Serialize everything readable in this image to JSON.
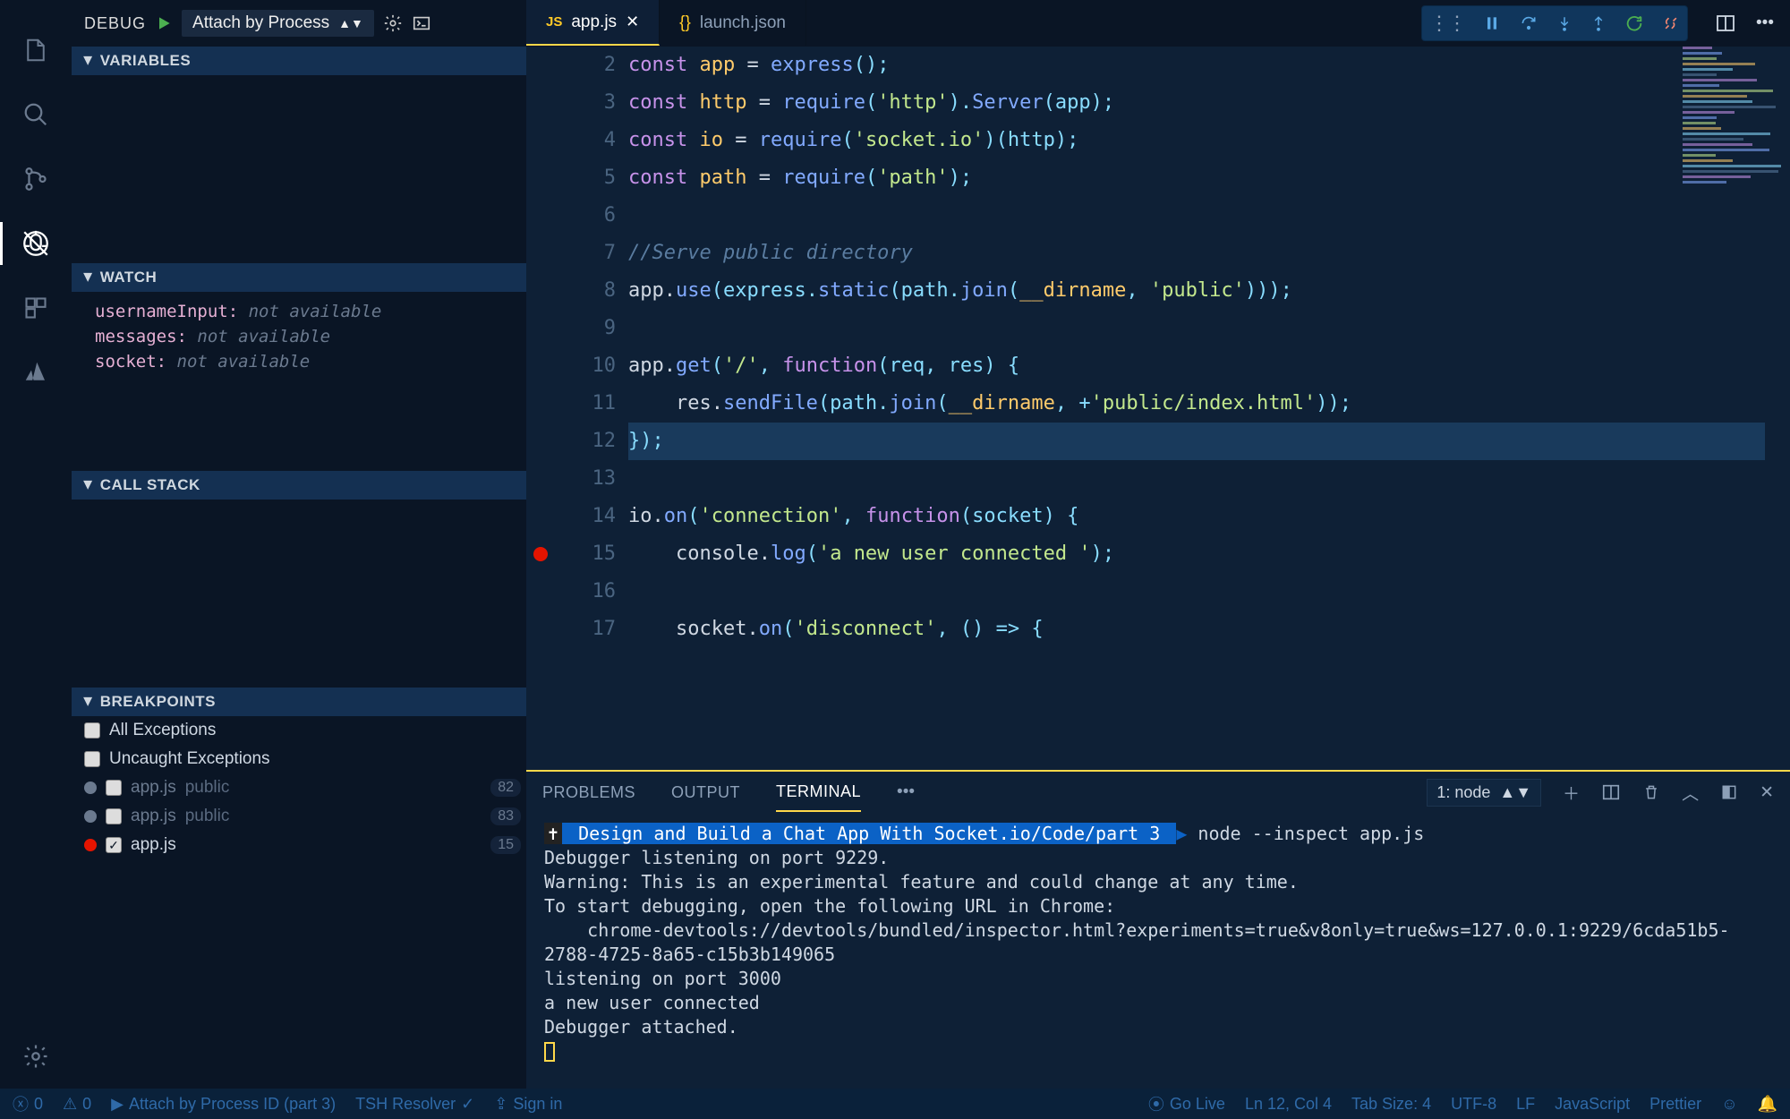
{
  "debugHeader": {
    "label": "DEBUG",
    "config": "Attach by Process"
  },
  "sections": {
    "variables": "VARIABLES",
    "watch": "WATCH",
    "callStack": "CALL STACK",
    "breakpoints": "BREAKPOINTS"
  },
  "watch": [
    {
      "name": "usernameInput:",
      "val": "not available"
    },
    {
      "name": "messages:",
      "val": "not available"
    },
    {
      "name": "socket:",
      "val": "not available"
    }
  ],
  "breakpoints": {
    "allExc": "All Exceptions",
    "uncaughtExc": "Uncaught Exceptions",
    "rows": [
      {
        "dot": "grey",
        "checked": false,
        "name": "app.js",
        "sub": "public",
        "line": "82",
        "dim": true
      },
      {
        "dot": "grey",
        "checked": false,
        "name": "app.js",
        "sub": "public",
        "line": "83",
        "dim": true
      },
      {
        "dot": "red",
        "checked": true,
        "name": "app.js",
        "sub": "",
        "line": "15",
        "dim": false
      }
    ]
  },
  "tabs": [
    {
      "icon": "js",
      "iconText": "JS",
      "label": "app.js",
      "active": true,
      "close": true
    },
    {
      "icon": "json",
      "iconText": "{}",
      "label": "launch.json",
      "active": false,
      "close": false
    }
  ],
  "code": {
    "firstLine": 2,
    "highlightLine": 12,
    "breakpointLine": 15,
    "lines": [
      [
        {
          "t": "const ",
          "c": "kw"
        },
        {
          "t": "app",
          "c": "var"
        },
        {
          "t": " = ",
          "c": "nm"
        },
        {
          "t": "express",
          "c": "fn"
        },
        {
          "t": "();",
          "c": "par"
        }
      ],
      [
        {
          "t": "const ",
          "c": "kw"
        },
        {
          "t": "http",
          "c": "var"
        },
        {
          "t": " = ",
          "c": "nm"
        },
        {
          "t": "require",
          "c": "fn"
        },
        {
          "t": "(",
          "c": "par"
        },
        {
          "t": "'http'",
          "c": "str"
        },
        {
          "t": ").",
          "c": "par"
        },
        {
          "t": "Server",
          "c": "fn"
        },
        {
          "t": "(app);",
          "c": "par"
        }
      ],
      [
        {
          "t": "const ",
          "c": "kw"
        },
        {
          "t": "io",
          "c": "var"
        },
        {
          "t": " = ",
          "c": "nm"
        },
        {
          "t": "require",
          "c": "fn"
        },
        {
          "t": "(",
          "c": "par"
        },
        {
          "t": "'socket.io'",
          "c": "str"
        },
        {
          "t": ")(http);",
          "c": "par"
        }
      ],
      [
        {
          "t": "const ",
          "c": "kw"
        },
        {
          "t": "path",
          "c": "var"
        },
        {
          "t": " = ",
          "c": "nm"
        },
        {
          "t": "require",
          "c": "fn"
        },
        {
          "t": "(",
          "c": "par"
        },
        {
          "t": "'path'",
          "c": "str"
        },
        {
          "t": ");",
          "c": "par"
        }
      ],
      [],
      [
        {
          "t": "//Serve public directory",
          "c": "cm"
        }
      ],
      [
        {
          "t": "app.",
          "c": "nm"
        },
        {
          "t": "use",
          "c": "fn"
        },
        {
          "t": "(express.",
          "c": "par"
        },
        {
          "t": "static",
          "c": "fn"
        },
        {
          "t": "(path.",
          "c": "par"
        },
        {
          "t": "join",
          "c": "fn"
        },
        {
          "t": "(",
          "c": "par"
        },
        {
          "t": "__dirname",
          "c": "var"
        },
        {
          "t": ", ",
          "c": "par"
        },
        {
          "t": "'public'",
          "c": "str"
        },
        {
          "t": ")));",
          "c": "par"
        }
      ],
      [],
      [
        {
          "t": "app.",
          "c": "nm"
        },
        {
          "t": "get",
          "c": "fn"
        },
        {
          "t": "(",
          "c": "par"
        },
        {
          "t": "'/'",
          "c": "str"
        },
        {
          "t": ", ",
          "c": "par"
        },
        {
          "t": "function",
          "c": "kw"
        },
        {
          "t": "(req, res) {",
          "c": "par"
        }
      ],
      [
        {
          "t": "    res.",
          "c": "nm"
        },
        {
          "t": "sendFile",
          "c": "fn"
        },
        {
          "t": "(path.",
          "c": "par"
        },
        {
          "t": "join",
          "c": "fn"
        },
        {
          "t": "(",
          "c": "par"
        },
        {
          "t": "__dirname",
          "c": "var"
        },
        {
          "t": ", +",
          "c": "par"
        },
        {
          "t": "'public/index.html'",
          "c": "str"
        },
        {
          "t": "));",
          "c": "par"
        }
      ],
      [
        {
          "t": "});",
          "c": "par"
        }
      ],
      [],
      [
        {
          "t": "io.",
          "c": "nm"
        },
        {
          "t": "on",
          "c": "fn"
        },
        {
          "t": "(",
          "c": "par"
        },
        {
          "t": "'connection'",
          "c": "str"
        },
        {
          "t": ", ",
          "c": "par"
        },
        {
          "t": "function",
          "c": "kw"
        },
        {
          "t": "(socket) {",
          "c": "par"
        }
      ],
      [
        {
          "t": "    console.",
          "c": "nm"
        },
        {
          "t": "log",
          "c": "fn"
        },
        {
          "t": "(",
          "c": "par"
        },
        {
          "t": "'a new user connected '",
          "c": "str"
        },
        {
          "t": ");",
          "c": "par"
        }
      ],
      [],
      [
        {
          "t": "    socket.",
          "c": "nm"
        },
        {
          "t": "on",
          "c": "fn"
        },
        {
          "t": "(",
          "c": "par"
        },
        {
          "t": "'disconnect'",
          "c": "str"
        },
        {
          "t": ", () => {",
          "c": "par"
        }
      ]
    ]
  },
  "panel": {
    "tabs": {
      "problems": "PROBLEMS",
      "output": "OUTPUT",
      "terminal": "TERMINAL"
    },
    "select": "1: node",
    "promptPath": " Design and Build a Chat App With Socket.io/Code/part 3 ",
    "promptCmd": " node --inspect app.js",
    "lines": [
      "Debugger listening on port 9229.",
      "Warning: This is an experimental feature and could change at any time.",
      "To start debugging, open the following URL in Chrome:",
      "    chrome-devtools://devtools/bundled/inspector.html?experiments=true&v8only=true&ws=127.0.0.1:9229/6cda51b5-2788-4725-8a65-c15b3b149065",
      "listening on port 3000",
      "a new user connected",
      "Debugger attached."
    ]
  },
  "status": {
    "errors": "0",
    "warnings": "0",
    "debugCfg": "Attach by Process ID (part 3)",
    "tsh": "TSH Resolver",
    "signin": "Sign in",
    "golive": "Go Live",
    "lncol": "Ln 12, Col 4",
    "tabsize": "Tab Size: 4",
    "encoding": "UTF-8",
    "eol": "LF",
    "lang": "JavaScript",
    "prettier": "Prettier"
  }
}
